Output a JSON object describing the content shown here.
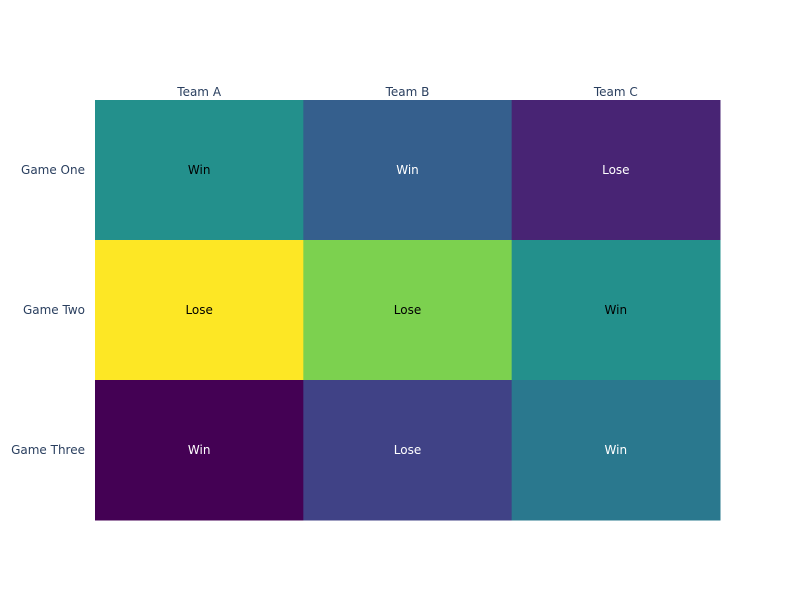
{
  "chart_data": {
    "type": "heatmap",
    "title": "",
    "xlabel": "",
    "ylabel": "",
    "x": [
      "Team A",
      "Team B",
      "Team C"
    ],
    "y": [
      "Game One",
      "Game Two",
      "Game Three"
    ],
    "z": [
      [
        0.5,
        0.3,
        0.1
      ],
      [
        1.0,
        0.8,
        0.5
      ],
      [
        0.0,
        0.2,
        0.4
      ]
    ],
    "text": [
      [
        "Win",
        "Win",
        "Lose"
      ],
      [
        "Lose",
        "Lose",
        "Win"
      ],
      [
        "Win",
        "Lose",
        "Win"
      ]
    ],
    "colorscale": "Viridis",
    "x_axis_position": "top",
    "y_axis_reversed": true,
    "show_colorbar": false,
    "grid": false
  },
  "colors": {
    "axis_text": "#2a3f5f",
    "viridis_stops": [
      "#440154",
      "#482878",
      "#3e4989",
      "#31688e",
      "#26828e",
      "#1f9e89",
      "#35b779",
      "#6ece58",
      "#b5de2b",
      "#fde725"
    ]
  }
}
